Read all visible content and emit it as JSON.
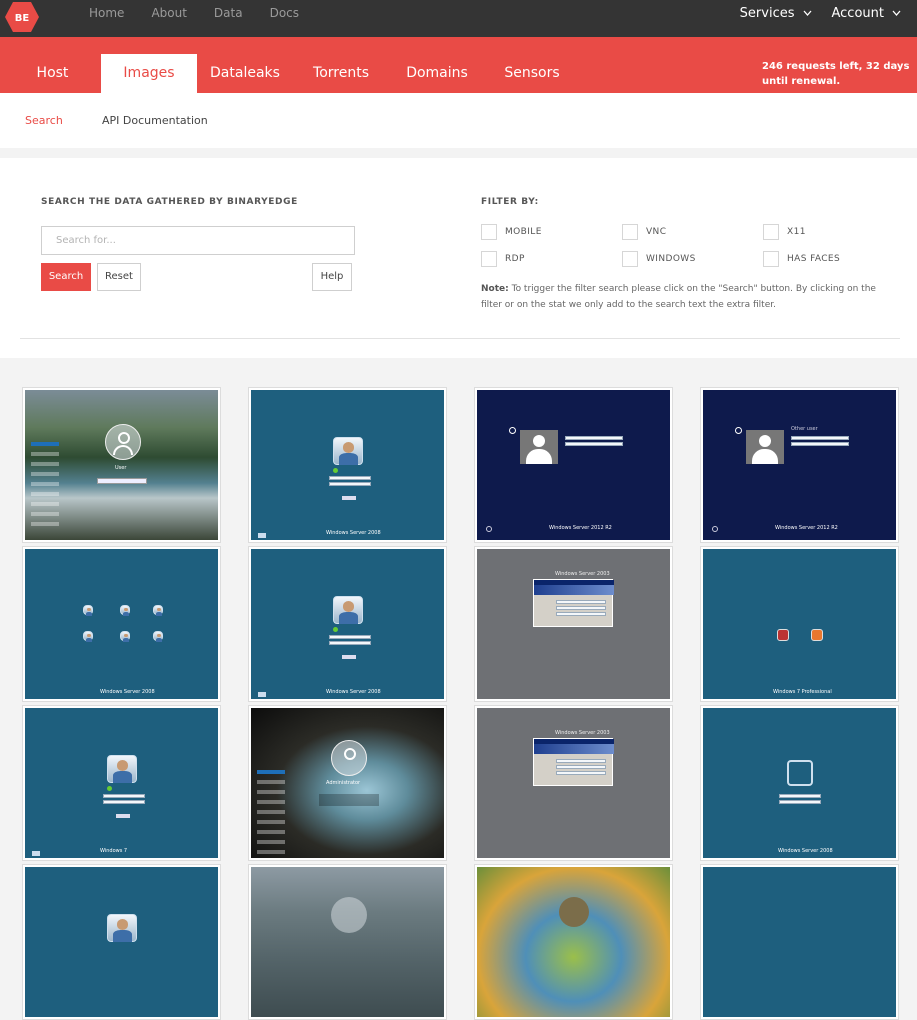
{
  "brand": {
    "logo_text": "BE"
  },
  "topnav": [
    "Home",
    "About",
    "Data",
    "Docs"
  ],
  "topright": {
    "services": "Services",
    "account": "Account"
  },
  "tabs": [
    {
      "label": "Host"
    },
    {
      "label": "Images"
    },
    {
      "label": "Dataleaks"
    },
    {
      "label": "Torrents"
    },
    {
      "label": "Domains"
    },
    {
      "label": "Sensors"
    }
  ],
  "active_tab": "Images",
  "quota": {
    "requests": "246",
    "requests_text": " requests left, ",
    "days": "32",
    "days_text": " days until renewal."
  },
  "subnav": {
    "search": "Search",
    "api_docs": "API Documentation"
  },
  "search": {
    "title": "SEARCH THE DATA GATHERED BY BINARYEDGE",
    "placeholder": "Search for...",
    "search_button": "Search",
    "reset_button": "Reset",
    "help_button": "Help"
  },
  "filters": {
    "title": "FILTER BY:",
    "options": [
      "MOBILE",
      "VNC",
      "X11",
      "RDP",
      "WINDOWS",
      "HAS FACES"
    ],
    "note_label": "Note:",
    "note_text": " To trigger the filter search please click on the \"Search\" button. By clicking on the filter or on the stat we only add to the search text the extra filter."
  },
  "thumbnails": [
    {
      "kind": "win10-landscape",
      "caption": "User"
    },
    {
      "kind": "server2008-cn",
      "caption": "Windows Server 2008"
    },
    {
      "kind": "server2012",
      "caption": "Windows Server 2012 R2"
    },
    {
      "kind": "server2012-other",
      "caption": "Windows Server 2012 R2",
      "extra": "Other user"
    },
    {
      "kind": "server2008-users",
      "caption": "Windows Server 2008"
    },
    {
      "kind": "server2008-cn",
      "caption": "Windows Server 2008"
    },
    {
      "kind": "gray-dialog",
      "caption": "Windows Server 2003"
    },
    {
      "kind": "win7-users",
      "caption": "Windows 7 Professional"
    },
    {
      "kind": "win7-cn",
      "caption": "Windows 7"
    },
    {
      "kind": "win10-cave",
      "caption": "Administrator"
    },
    {
      "kind": "gray-dialog",
      "caption": "Windows Server 2003"
    },
    {
      "kind": "server2008-blank",
      "caption": "Windows Server 2008"
    },
    {
      "kind": "blue-partial",
      "caption": ""
    },
    {
      "kind": "mountain-partial",
      "caption": ""
    },
    {
      "kind": "blur-partial",
      "caption": ""
    },
    {
      "kind": "blue-plain-partial",
      "caption": ""
    }
  ],
  "colors": {
    "accent": "#e94b46",
    "topbar": "#343434",
    "win_teal": "#1e5f7e",
    "win_navy": "#0e1a4c",
    "gray_desktop": "#6e7074"
  }
}
